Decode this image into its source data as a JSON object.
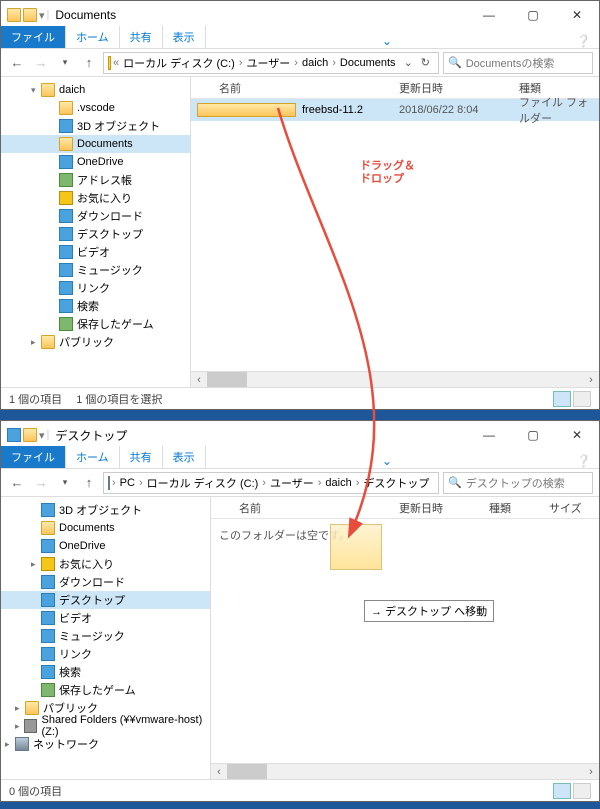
{
  "window1": {
    "title": "Documents",
    "tabs": {
      "file": "ファイル",
      "home": "ホーム",
      "share": "共有",
      "view": "表示"
    },
    "breadcrumbs": [
      "ローカル ディスク (C:)",
      "ユーザー",
      "daich",
      "Documents"
    ],
    "search_placeholder": "Documentsの検索",
    "columns": {
      "name": "名前",
      "date": "更新日時",
      "type": "種類"
    },
    "tree": [
      {
        "label": "daich",
        "icon": "folder-ico",
        "indent": 30,
        "chev": "▾"
      },
      {
        "label": ".vscode",
        "icon": "folder-ico",
        "indent": 48
      },
      {
        "label": "3D オブジェクト",
        "icon": "blue-ico",
        "indent": 48
      },
      {
        "label": "Documents",
        "icon": "folder-ico",
        "indent": 48,
        "sel": true
      },
      {
        "label": "OneDrive",
        "icon": "blue-ico",
        "indent": 48
      },
      {
        "label": "アドレス帳",
        "icon": "green-ico",
        "indent": 48
      },
      {
        "label": "お気に入り",
        "icon": "star-ico",
        "indent": 48
      },
      {
        "label": "ダウンロード",
        "icon": "blue-ico",
        "indent": 48
      },
      {
        "label": "デスクトップ",
        "icon": "blue-ico",
        "indent": 48
      },
      {
        "label": "ビデオ",
        "icon": "blue-ico",
        "indent": 48
      },
      {
        "label": "ミュージック",
        "icon": "blue-ico",
        "indent": 48
      },
      {
        "label": "リンク",
        "icon": "blue-ico",
        "indent": 48
      },
      {
        "label": "検索",
        "icon": "blue-ico",
        "indent": 48
      },
      {
        "label": "保存したゲーム",
        "icon": "green-ico",
        "indent": 48
      },
      {
        "label": "パブリック",
        "icon": "folder-ico",
        "indent": 30,
        "chev": "▸"
      }
    ],
    "rows": [
      {
        "name": "freebsd-11.2",
        "date": "2018/06/22 8:04",
        "type": "ファイル フォルダー",
        "sel": true
      }
    ],
    "status": {
      "count": "1 個の項目",
      "sel": "1 個の項目を選択"
    }
  },
  "window2": {
    "title": "デスクトップ",
    "tabs": {
      "file": "ファイル",
      "home": "ホーム",
      "share": "共有",
      "view": "表示"
    },
    "breadcrumbs": [
      "PC",
      "ローカル ディスク (C:)",
      "ユーザー",
      "daich",
      "デスクトップ"
    ],
    "search_placeholder": "デスクトップの検索",
    "columns": {
      "name": "名前",
      "date": "更新日時",
      "type": "種類",
      "size": "サイズ"
    },
    "tree": [
      {
        "label": "3D オブジェクト",
        "icon": "blue-ico",
        "indent": 30
      },
      {
        "label": "Documents",
        "icon": "folder-ico",
        "indent": 30
      },
      {
        "label": "OneDrive",
        "icon": "blue-ico",
        "indent": 30
      },
      {
        "label": "お気に入り",
        "icon": "star-ico",
        "indent": 30,
        "chev": "▸"
      },
      {
        "label": "ダウンロード",
        "icon": "blue-ico",
        "indent": 30
      },
      {
        "label": "デスクトップ",
        "icon": "blue-ico",
        "indent": 30,
        "sel": true
      },
      {
        "label": "ビデオ",
        "icon": "blue-ico",
        "indent": 30
      },
      {
        "label": "ミュージック",
        "icon": "blue-ico",
        "indent": 30
      },
      {
        "label": "リンク",
        "icon": "blue-ico",
        "indent": 30
      },
      {
        "label": "検索",
        "icon": "blue-ico",
        "indent": 30
      },
      {
        "label": "保存したゲーム",
        "icon": "green-ico",
        "indent": 30
      },
      {
        "label": "パブリック",
        "icon": "folder-ico",
        "indent": 14,
        "chev": "▸"
      },
      {
        "label": "Shared Folders (¥¥vmware-host) (Z:)",
        "icon": "drive-ico",
        "indent": 14,
        "chev": "▸"
      },
      {
        "label": "ネットワーク",
        "icon": "pc-ico",
        "indent": 4,
        "chev": "▸"
      }
    ],
    "empty_msg": "このフォルダーは空です。",
    "drop_tip": "→ デスクトップ へ移動",
    "status": {
      "count": "0 個の項目"
    }
  },
  "annotation": "ドラッグ＆\nドロップ"
}
